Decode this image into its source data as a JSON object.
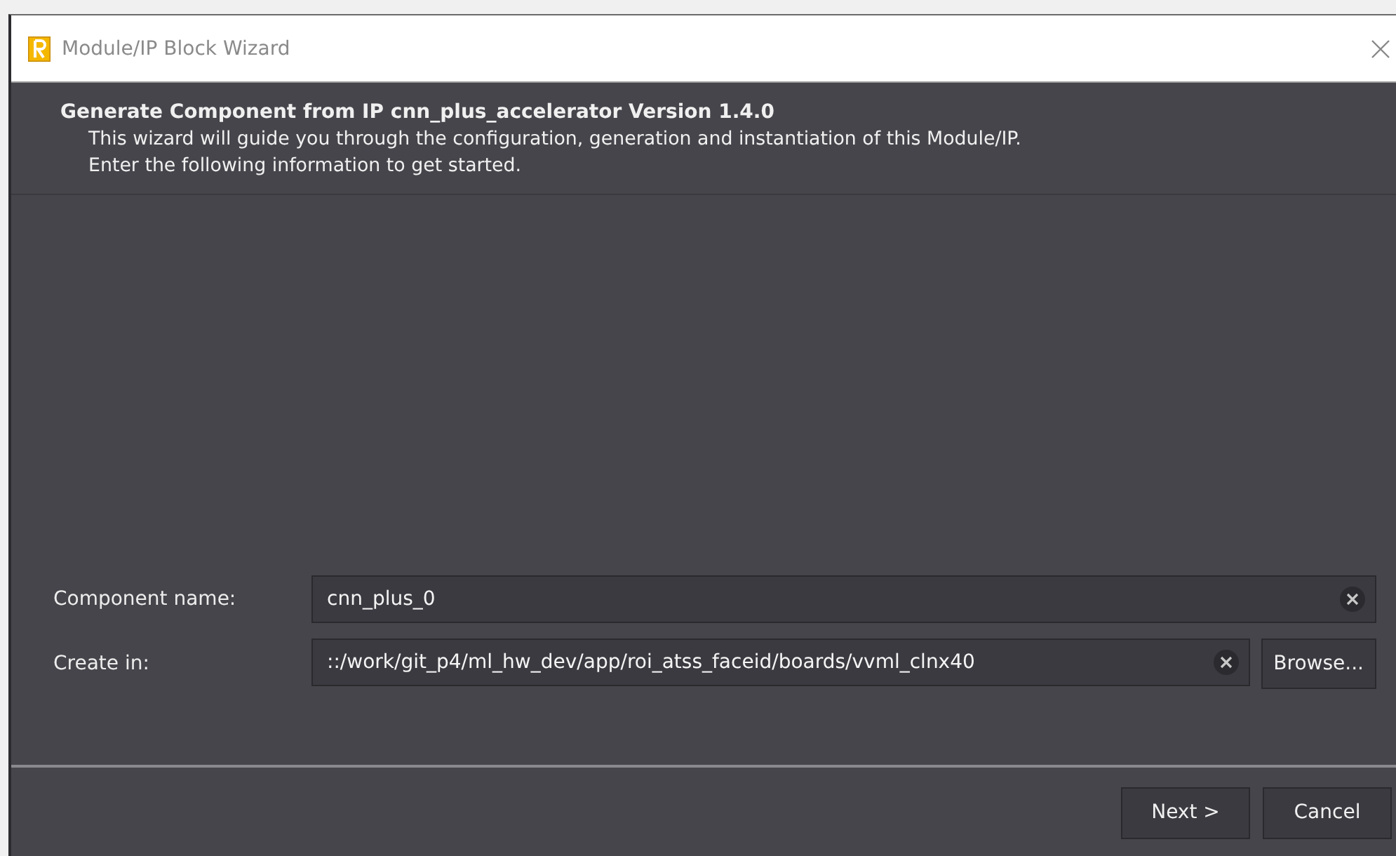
{
  "window": {
    "title": "Module/IP Block Wizard"
  },
  "header": {
    "title": "Generate Component from IP cnn_plus_accelerator Version 1.4.0",
    "description": "This wizard will guide you through the configuration, generation and instantiation of this Module/IP.",
    "instruction": "Enter the following information to get started."
  },
  "fields": [
    {
      "label": "Component name:",
      "value": "cnn_plus_0"
    },
    {
      "label": "Create in:",
      "value": "::/work/git_p4/ml_hw_dev/app/roi_atss_faceid/boards/vvml_clnx40",
      "button": "Browse..."
    }
  ],
  "buttons": [
    "Next >",
    "Cancel"
  ]
}
